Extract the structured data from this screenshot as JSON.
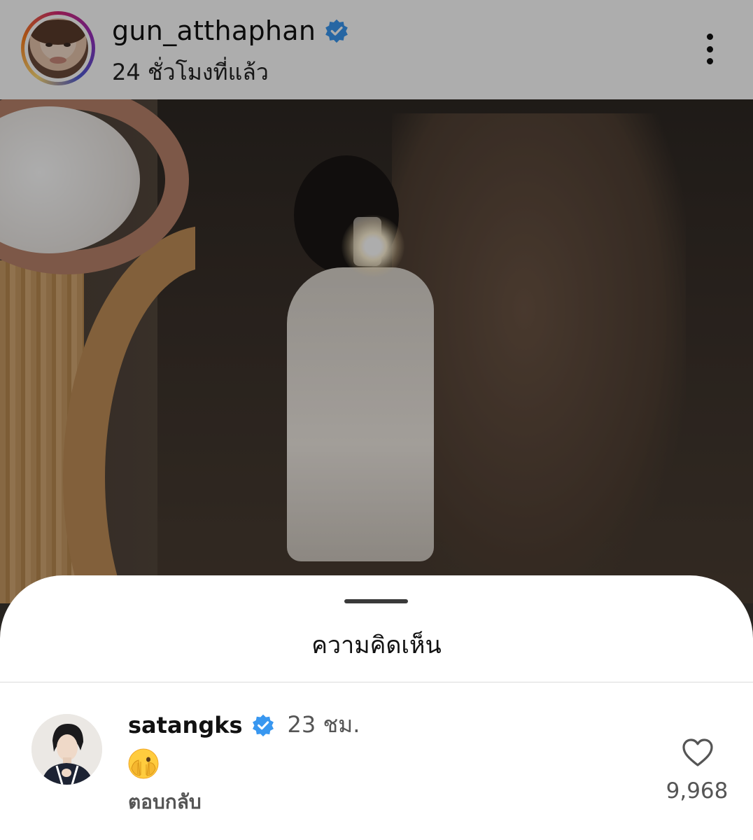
{
  "post": {
    "username": "gun_atthaphan",
    "verified": true,
    "timestamp": "24 ชั่วโมงที่แล้ว",
    "more_icon": "more-vertical-icon"
  },
  "sheet": {
    "title": "ความคิดเห็น"
  },
  "comment": {
    "username": "satangks",
    "verified": true,
    "time": "23 ชม.",
    "emoji": "face-with-peeking-eye",
    "reply_label": "ตอบกลับ",
    "like_icon": "heart-outline-icon",
    "like_count": "9,968"
  },
  "colors": {
    "verified_blue": "#3897f0",
    "text_primary": "#111111",
    "text_secondary": "#555555",
    "sheet_background": "#ffffff"
  }
}
